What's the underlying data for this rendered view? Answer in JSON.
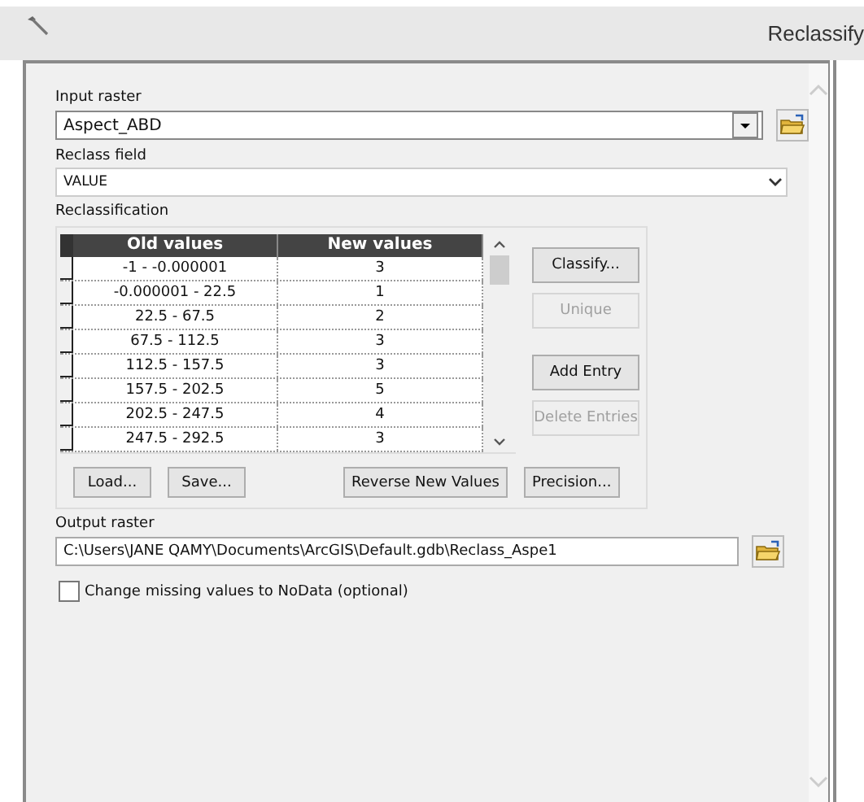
{
  "window": {
    "title": "Reclassify"
  },
  "input_raster": {
    "label": "Input raster",
    "value": "Aspect_ABD"
  },
  "reclass_field": {
    "label": "Reclass field",
    "value": "VALUE"
  },
  "reclassification": {
    "label": "Reclassification",
    "table": {
      "columns": [
        "Old values",
        "New values"
      ],
      "rows": [
        {
          "old": "-1 - -0.000001",
          "new": "3"
        },
        {
          "old": "-0.000001 - 22.5",
          "new": "1"
        },
        {
          "old": "22.5 - 67.5",
          "new": "2"
        },
        {
          "old": "67.5 - 112.5",
          "new": "3"
        },
        {
          "old": "112.5 - 157.5",
          "new": "3"
        },
        {
          "old": "157.5 - 202.5",
          "new": "5"
        },
        {
          "old": "202.5 - 247.5",
          "new": "4"
        },
        {
          "old": "247.5 - 292.5",
          "new": "3"
        }
      ]
    },
    "side_buttons": [
      {
        "label": "Classify...",
        "disabled": false
      },
      {
        "label": "Unique",
        "disabled": true
      },
      {
        "label": "Add Entry",
        "disabled": false
      },
      {
        "label": "Delete Entries",
        "disabled": true
      }
    ],
    "bottom_buttons": [
      {
        "label": "Load...",
        "disabled": false
      },
      {
        "label": "Save...",
        "disabled": false
      },
      {
        "label": "Reverse New Values",
        "disabled": false
      },
      {
        "label": "Precision...",
        "disabled": false
      }
    ]
  },
  "output_raster": {
    "label": "Output raster",
    "value": "C:\\Users\\JANE QAMY\\Documents\\ArcGIS\\Default.gdb\\Reclass_Aspe1"
  },
  "nodata_option": {
    "label": "Change missing values to NoData (optional)",
    "checked": false
  }
}
